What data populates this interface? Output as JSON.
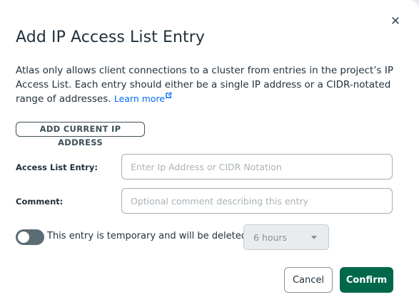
{
  "dialog": {
    "title": "Add IP Access List Entry",
    "close_symbol": "✕",
    "description": "Atlas only allows client connections to a cluster from entries in the project’s IP Access List. Each entry should either be a single IP address or a CIDR-notated range of addresses.",
    "learn_more_label": "Learn more",
    "add_current_ip_label": "ADD CURRENT IP ADDRESS",
    "access_entry": {
      "label": "Access List Entry:",
      "value": "",
      "placeholder": "Enter Ip Address or CIDR Notation"
    },
    "comment": {
      "label": "Comment:",
      "value": "",
      "placeholder": "Optional comment describing this entry"
    },
    "temporary": {
      "enabled": false,
      "label": "This entry is temporary and will be deleted in",
      "duration_selected": "6 hours"
    },
    "cancel_label": "Cancel",
    "confirm_label": "Confirm"
  },
  "icons": {
    "close": "close-icon",
    "external_link": "external-link-icon",
    "dropdown": "chevron-down-icon"
  },
  "colors": {
    "primary": "#00684a",
    "link": "#016bf8",
    "text": "#21313c",
    "toggle_off": "#5c6c75"
  }
}
